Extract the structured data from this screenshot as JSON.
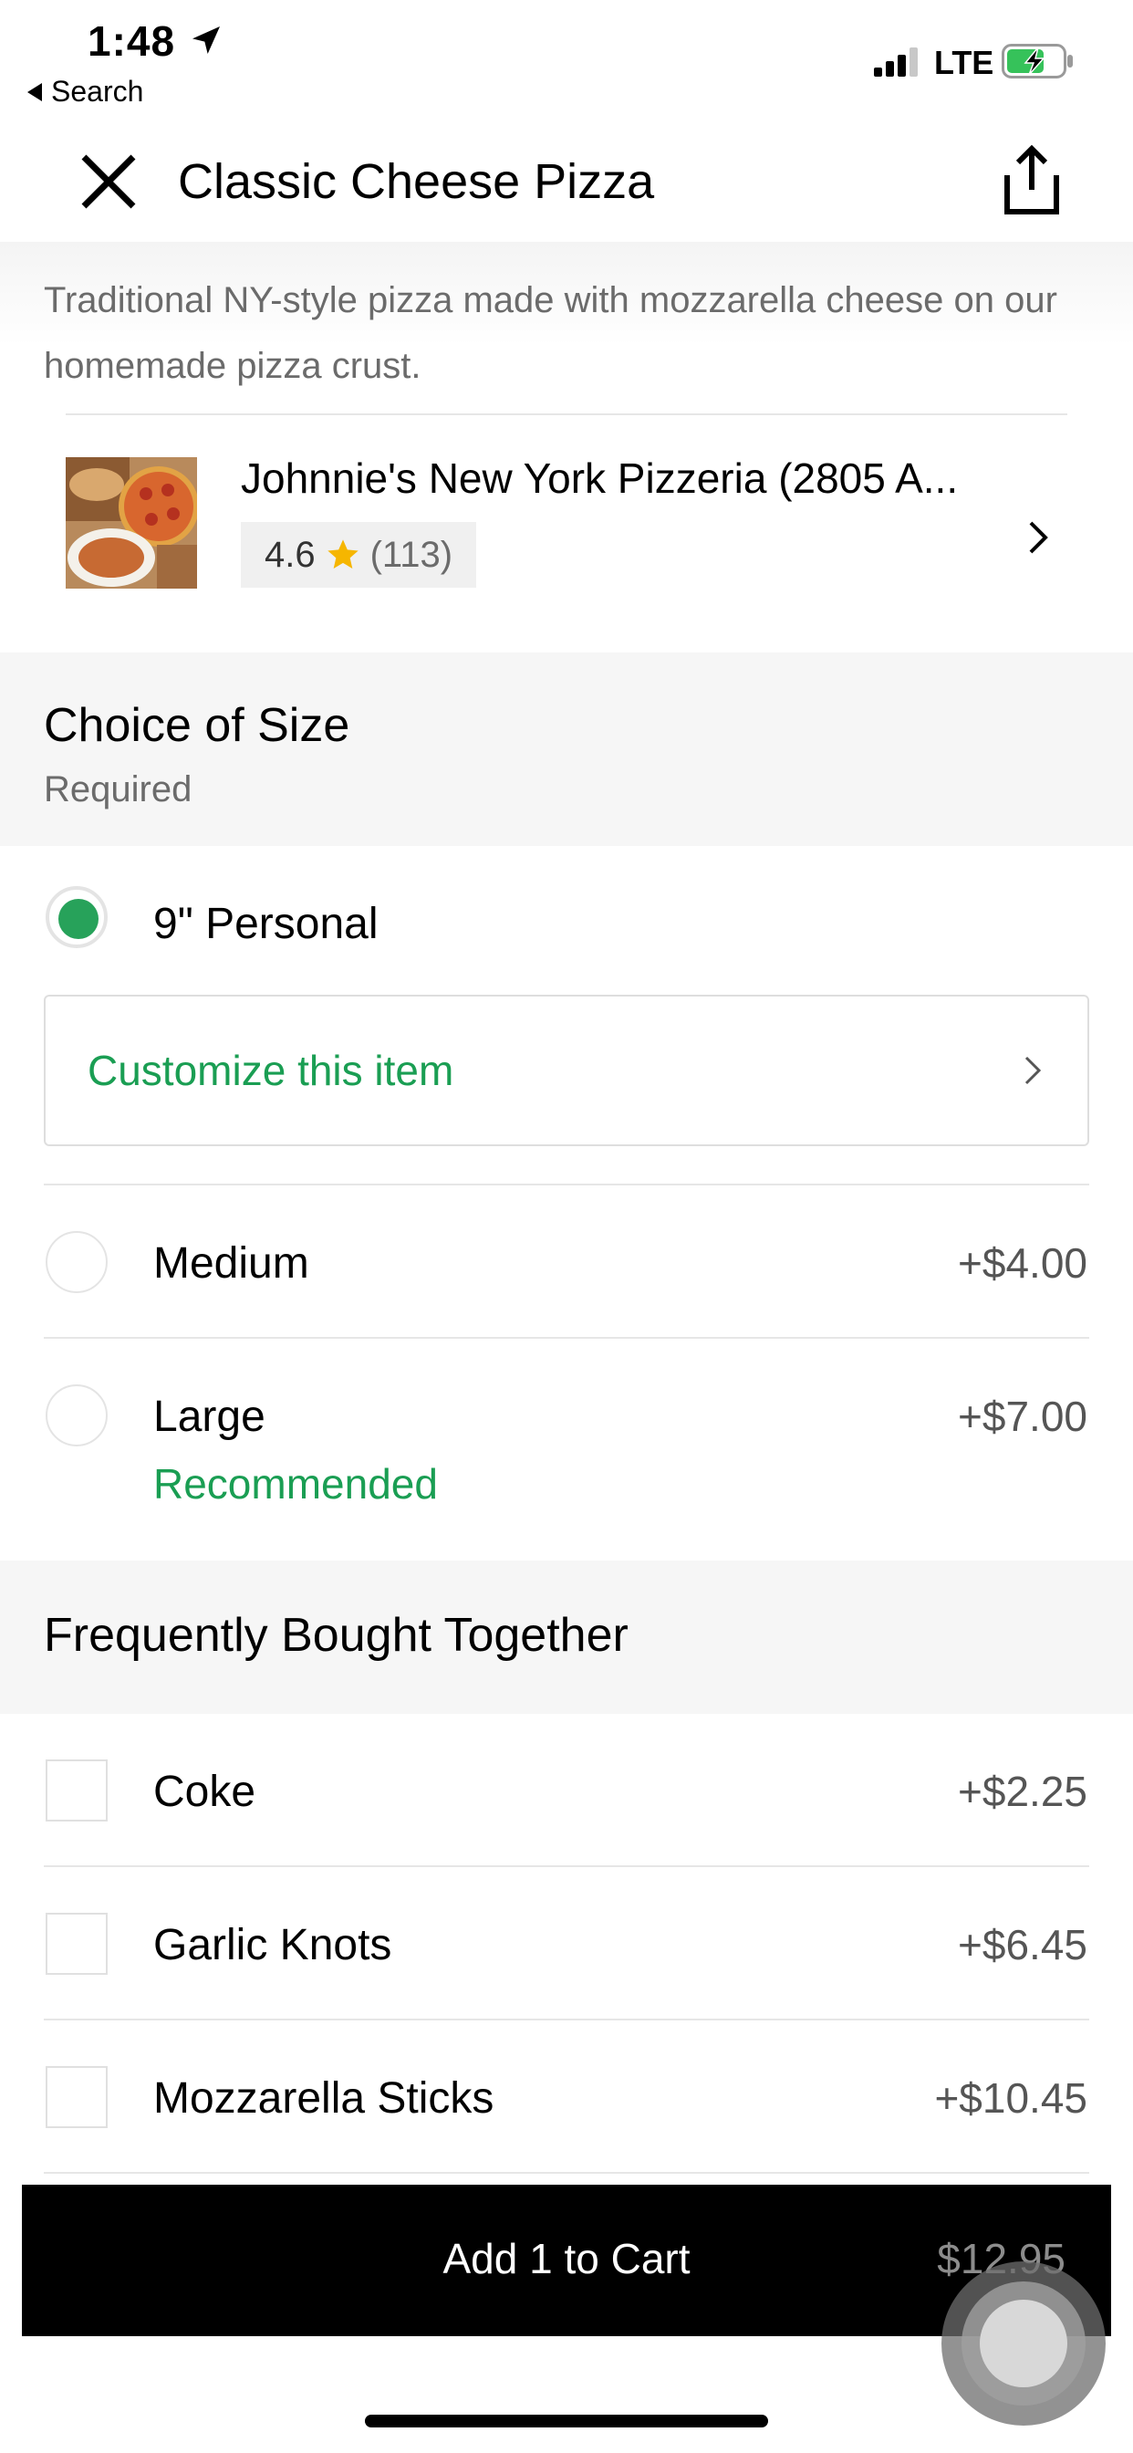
{
  "status_bar": {
    "time": "1:48",
    "back_label": "Search",
    "network": "LTE"
  },
  "header": {
    "title": "Classic Cheese Pizza"
  },
  "description": "Traditional NY-style pizza made with mozzarella cheese on our homemade pizza crust.",
  "restaurant": {
    "name": "Johnnie's New York Pizzeria (2805 A...",
    "rating": "4.6",
    "review_count": "(113)"
  },
  "size_section": {
    "title": "Choice of Size",
    "subtitle": "Required",
    "options": [
      {
        "label": "9\" Personal",
        "price": "",
        "selected": true
      },
      {
        "label": "Medium",
        "price": "+$4.00",
        "selected": false
      },
      {
        "label": "Large",
        "price": "+$7.00",
        "selected": false,
        "tag": "Recommended"
      }
    ],
    "customize_label": "Customize this item"
  },
  "fbt_section": {
    "title": "Frequently Bought Together",
    "items": [
      {
        "label": "Coke",
        "price": "+$2.25"
      },
      {
        "label": "Garlic Knots",
        "price": "+$6.45"
      },
      {
        "label": "Mozzarella Sticks",
        "price": "+$10.45"
      }
    ]
  },
  "cart": {
    "label": "Add 1 to Cart",
    "price": "$12.95"
  },
  "colors": {
    "accent_green": "#27a25a",
    "text_green": "#1a9e53",
    "cart_bg": "#000000"
  },
  "icons": [
    "location-arrow-icon",
    "back-triangle-icon",
    "signal-icon",
    "battery-charging-icon",
    "close-icon",
    "share-icon",
    "star-icon",
    "chevron-right-icon"
  ]
}
